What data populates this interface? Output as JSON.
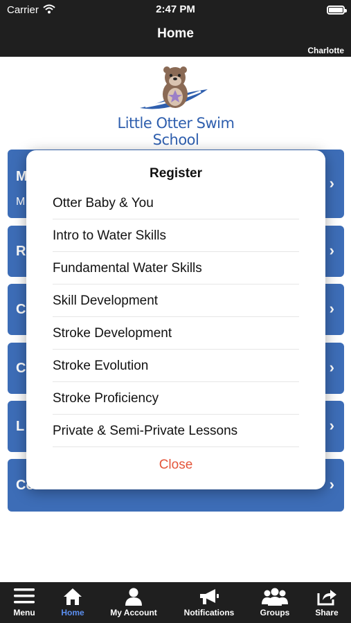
{
  "status_bar": {
    "carrier": "Carrier",
    "time": "2:47 PM"
  },
  "header": {
    "title": "Home",
    "location": "Charlotte"
  },
  "logo": {
    "text": "Little Otter Swim School"
  },
  "menu": {
    "items": [
      {
        "label": "M",
        "sub": "M"
      },
      {
        "label": "R"
      },
      {
        "label": "C"
      },
      {
        "label": "C"
      },
      {
        "label": "L"
      },
      {
        "label": "Contact Us"
      }
    ]
  },
  "modal": {
    "title": "Register",
    "options": [
      "Otter Baby & You",
      "Intro to Water Skills",
      "Fundamental Water Skills",
      "Skill Development",
      "Stroke Development",
      "Stroke Evolution",
      "Stroke Proficiency",
      "Private & Semi-Private Lessons"
    ],
    "close_label": "Close"
  },
  "tabs": [
    {
      "label": "Menu",
      "icon": "menu-icon"
    },
    {
      "label": "Home",
      "icon": "home-icon",
      "active": true
    },
    {
      "label": "My Account",
      "icon": "account-icon"
    },
    {
      "label": "Notifications",
      "icon": "megaphone-icon"
    },
    {
      "label": "Groups",
      "icon": "groups-icon"
    },
    {
      "label": "Share",
      "icon": "share-icon"
    }
  ],
  "colors": {
    "bar": "#1f1f1f",
    "menu_blue": "#3d6db7",
    "active_tab": "#5b8ff0",
    "close_red": "#e4553a"
  }
}
